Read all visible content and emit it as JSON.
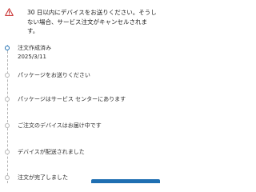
{
  "warning": {
    "icon": "warning-triangle-icon",
    "icon_color": "#c62828",
    "text": "30 日以内にデバイスをお送りください。そうしない場合、サービス注文がキャンセルされます。"
  },
  "timeline": {
    "accent_color": "#1f6fb2",
    "steps": [
      {
        "label": "注文作成済み",
        "date": "2025/3/11",
        "status": "completed"
      },
      {
        "label": "パッケージをお送りください",
        "status": "pending"
      },
      {
        "label": "パッケージはサービス センターにあります",
        "status": "pending"
      },
      {
        "label": "ご注文のデバイスはお届け中です",
        "status": "pending"
      },
      {
        "label": "デバイスが配送されました",
        "status": "pending"
      },
      {
        "label": "注文が完了しました",
        "status": "pending"
      }
    ]
  }
}
